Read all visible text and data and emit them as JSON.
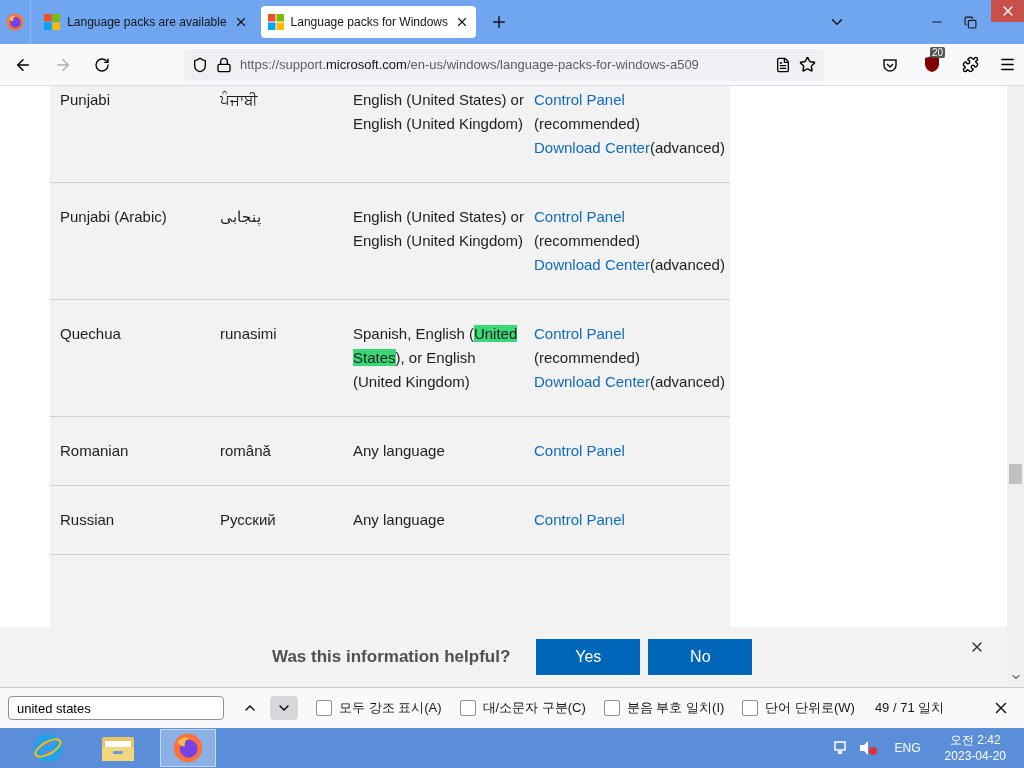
{
  "tabs": [
    {
      "title": "Language packs are available",
      "selected": false
    },
    {
      "title": "Language packs for Windows",
      "selected": true
    }
  ],
  "address": {
    "scheme": "https://support.",
    "host": "microsoft.com",
    "path": "/en-us/windows/language-packs-for-windows-a509"
  },
  "extension_badge": "20",
  "table": {
    "rows": [
      {
        "cut": true,
        "name": "Punjabi",
        "native": "ਪੰਜਾਬੀ",
        "languages": [
          {
            "text": "English (United States) or English (United Kingdom)",
            "highlight": false
          }
        ],
        "tools": [
          {
            "text": "Control Panel",
            "link": true
          },
          {
            "text": "(recommended)",
            "link": false
          },
          {
            "text": "Download Center",
            "link": true
          },
          {
            "text": "(advanced)",
            "link": false
          }
        ]
      },
      {
        "cut": false,
        "name": "Punjabi (Arabic)",
        "native": "پنجابی",
        "languages": [
          {
            "text": "English (United States) or English (United Kingdom)",
            "highlight": false
          }
        ],
        "tools": [
          {
            "text": "Control Panel",
            "link": true
          },
          {
            "text": "(recommended)",
            "link": false
          },
          {
            "text": "Download Center",
            "link": true
          },
          {
            "text": "(advanced)",
            "link": false
          }
        ]
      },
      {
        "cut": false,
        "name": "Quechua",
        "native": "runasimi",
        "languages": [
          {
            "text": "Spanish, English (",
            "highlight": false
          },
          {
            "text": "United States",
            "highlight": true
          },
          {
            "text": "), or English (United Kingdom)",
            "highlight": false
          }
        ],
        "tools": [
          {
            "text": "Control Panel",
            "link": true
          },
          {
            "text": "(recommended)",
            "link": false
          },
          {
            "text": "Download Center",
            "link": true
          },
          {
            "text": "(advanced)",
            "link": false
          }
        ]
      },
      {
        "cut": false,
        "name": "Romanian",
        "native": "română",
        "languages": [
          {
            "text": "Any language",
            "highlight": false
          }
        ],
        "tools": [
          {
            "text": "Control Panel",
            "link": true
          }
        ]
      },
      {
        "cut": false,
        "name": "Russian",
        "native": "Русский",
        "languages": [
          {
            "text": "Any language",
            "highlight": false
          }
        ],
        "tools": [
          {
            "text": "Control Panel",
            "link": true
          }
        ]
      }
    ]
  },
  "feedback": {
    "question": "Was this information helpful?",
    "buttons": [
      "Yes",
      "No"
    ]
  },
  "find_bar": {
    "value": "united states",
    "options": [
      {
        "label": "모두 강조 표시(A)",
        "checked": false
      },
      {
        "label": "대/소문자 구분(C)",
        "checked": false
      },
      {
        "label": "분음 부호 일치(I)",
        "checked": false
      },
      {
        "label": "단어 단위로(W)",
        "checked": false
      }
    ],
    "count": "49 / 71 일치"
  },
  "taskbar": {
    "apps": [
      {
        "kind": "ie",
        "selected": false
      },
      {
        "kind": "explorer",
        "selected": false
      },
      {
        "kind": "firefox",
        "selected": true
      }
    ],
    "language": "ENG",
    "time": "오전 2:42",
    "date": "2023-04-20"
  }
}
